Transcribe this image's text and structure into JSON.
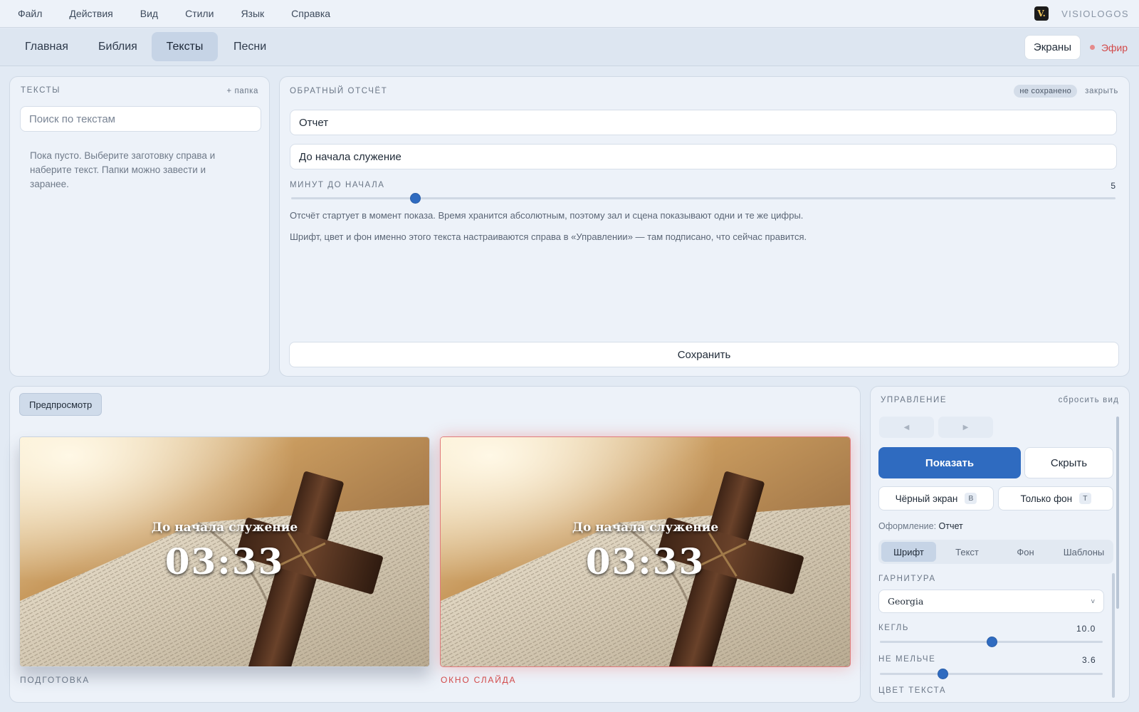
{
  "menubar": {
    "items": [
      "Файл",
      "Действия",
      "Вид",
      "Стили",
      "Язык",
      "Справка"
    ],
    "brand_logo": "V.",
    "brand_name": "VISIOLOGOS"
  },
  "tabs": {
    "items": [
      "Главная",
      "Библия",
      "Тексты",
      "Песни"
    ],
    "active": "Тексты",
    "screens_label": "Экраны",
    "live_label": "Эфир"
  },
  "texts_panel": {
    "title": "ТЕКСТЫ",
    "add_folder": "+ папка",
    "search_placeholder": "Поиск по текстам",
    "empty_note": "Пока пусто. Выберите заготовку справа и наберите текст. Папки можно завести и заранее."
  },
  "editor": {
    "title": "ОБРАТНЫЙ ОТСЧЁТ",
    "status_badge": "не сохранено",
    "close_label": "закрыть",
    "name_value": "Отчет",
    "caption_value": "До начала служение",
    "minutes_label": "МИНУТ ДО НАЧАЛА",
    "minutes_value": "5",
    "minutes_fraction": 0.15,
    "help_1": "Отсчёт стартует в момент показа. Время хранится абсолютным, поэтому зал и сцена показывают одни и те же цифры.",
    "help_2": "Шрифт, цвет и фон именно этого текста настраиваются справа в «Управлении» — там подписано, что сейчас правится.",
    "save_label": "Сохранить"
  },
  "preview": {
    "tag_label": "Предпросмотр",
    "caption": "До начала служение",
    "time": "03:33",
    "prep_label": "ПОДГОТОВКА",
    "live_label": "ОКНО СЛАЙДА"
  },
  "control": {
    "title": "УПРАВЛЕНИЕ",
    "reset_label": "сбросить вид",
    "prev_icon": "◀",
    "next_icon": "▶",
    "show_label": "Показать",
    "hide_label": "Скрыть",
    "black_label": "Чёрный экран",
    "black_key": "B",
    "bg_only_label": "Только фон",
    "bg_only_key": "T",
    "style_prefix": "Оформление:",
    "style_name": "Отчет",
    "seg_tabs": [
      "Шрифт",
      "Текст",
      "Фон",
      "Шаблоны"
    ],
    "seg_active": "Шрифт",
    "font_family_label": "ГАРНИТУРА",
    "font_family_value": "Georgia",
    "chevron": "v",
    "size_label": "КЕГЛЬ",
    "size_value": "10.0",
    "size_fraction": 0.5,
    "min_label": "НЕ МЕЛЬЧЕ",
    "min_value": "3.6",
    "min_fraction": 0.28,
    "color_label": "ЦВЕТ ТЕКСТА"
  },
  "colors": {
    "accent": "#2f6bc0",
    "live": "#d24a4a",
    "panel": "#edf2f9",
    "background": "#e2eaf4"
  }
}
